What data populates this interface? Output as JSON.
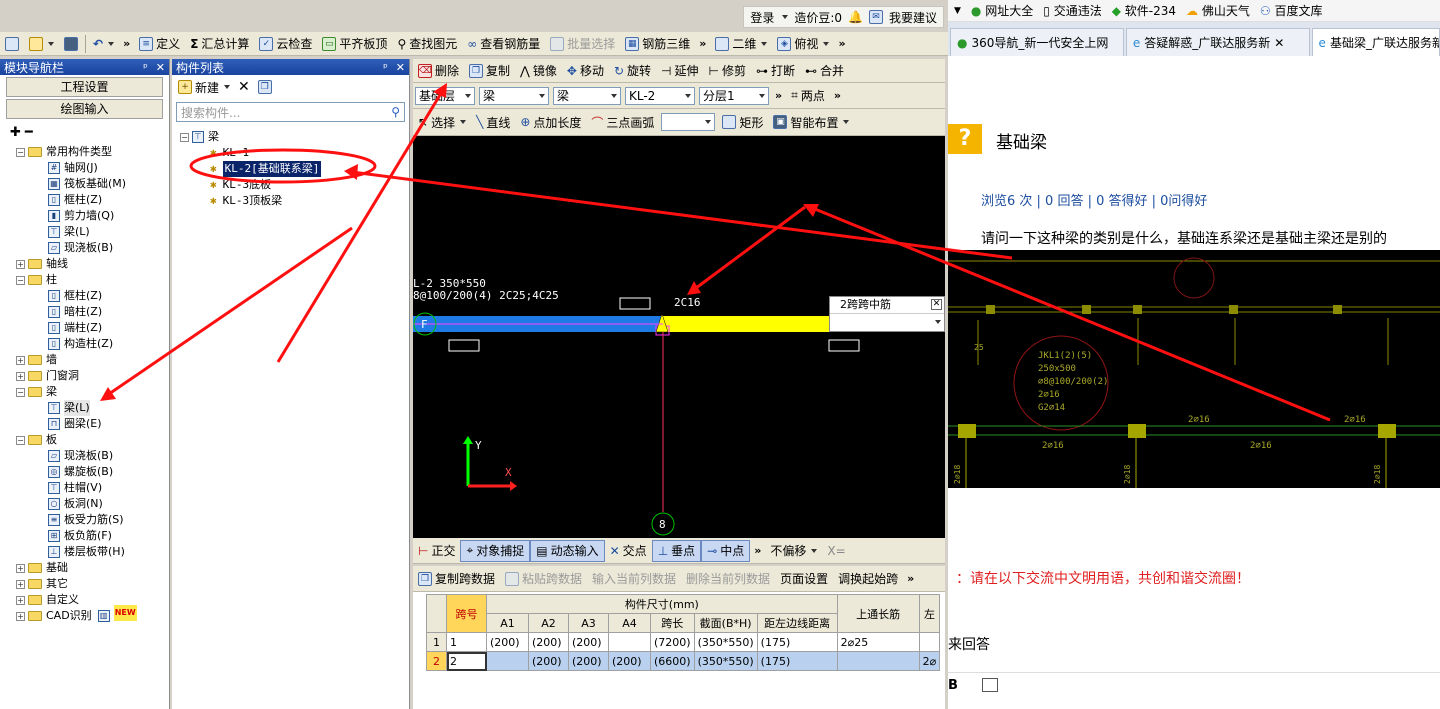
{
  "topbar": {
    "login": "登录",
    "cost_beans": "造价豆:0",
    "suggest": "我要建议"
  },
  "main_toolbar": {
    "items": [
      "定义",
      "汇总计算",
      "云检查",
      "平齐板顶",
      "查找图元",
      "查看钢筋量",
      "批量选择",
      "钢筋三维"
    ],
    "view_mode": "二维",
    "view_angle": "俯视"
  },
  "nav_panel": {
    "title": "模块导航栏",
    "project_settings": "工程设置",
    "drawing_input": "绘图输入",
    "tree": {
      "common": {
        "label": "常用构件类型",
        "children": [
          "轴网(J)",
          "筏板基础(M)",
          "框柱(Z)",
          "剪力墙(Q)",
          "梁(L)",
          "现浇板(B)"
        ]
      },
      "axis": "轴线",
      "column": {
        "label": "柱",
        "children": [
          "框柱(Z)",
          "暗柱(Z)",
          "端柱(Z)",
          "构造柱(Z)"
        ]
      },
      "wall": "墙",
      "doorwin": "门窗洞",
      "beam": {
        "label": "梁",
        "children": [
          "梁(L)",
          "圈梁(E)"
        ]
      },
      "slab": {
        "label": "板",
        "children": [
          "现浇板(B)",
          "螺旋板(B)",
          "柱帽(V)",
          "板洞(N)",
          "板受力筋(S)",
          "板负筋(F)",
          "楼层板带(H)"
        ]
      },
      "foundation": "基础",
      "other": "其它",
      "custom": "自定义",
      "cad": "CAD识别",
      "new_badge": "NEW"
    }
  },
  "comp_panel": {
    "title": "构件列表",
    "new_label": "新建",
    "search_placeholder": "搜索构件...",
    "group": "梁",
    "items": [
      "KL-1",
      "KL-2[基础联系梁]",
      "KL-3底板",
      "KL-3顶板梁"
    ]
  },
  "edit_toolbar": {
    "items": [
      "删除",
      "复制",
      "镜像",
      "移动",
      "旋转",
      "延伸",
      "修剪",
      "打断",
      "合并"
    ]
  },
  "props_toolbar": {
    "floor": "基础层",
    "type1": "梁",
    "type2": "梁",
    "name": "KL-2",
    "layer": "分层1",
    "two_point": "两点"
  },
  "draw_toolbar": {
    "items": [
      "选择",
      "直线",
      "点加长度",
      "三点画弧",
      "矩形",
      "智能布置"
    ]
  },
  "cad": {
    "label_line1": "L-2 350*550",
    "label_line2": "8@100/200(4) 2C25;4C25",
    "rebar_label": "2C16",
    "axis_f": "F",
    "axis_8": "8",
    "popup_text": "2跨跨中筋",
    "y_axis": "Y",
    "x_axis": "X"
  },
  "snap_bar": {
    "items": [
      "正交",
      "对象捕捉",
      "动态输入",
      "交点",
      "垂点",
      "中点"
    ],
    "offset": "不偏移",
    "x_field": "X="
  },
  "span_toolbar": {
    "items": [
      "复制跨数据",
      "粘贴跨数据",
      "输入当前列数据",
      "删除当前列数据",
      "页面设置",
      "调换起始跨"
    ]
  },
  "span_table": {
    "group_header": "构件尺寸(mm)",
    "col_span": "跨号",
    "col_top": "上通长筋",
    "sub_headers": [
      "A1",
      "A2",
      "A3",
      "A4",
      "跨长",
      "截面(B*H)",
      "距左边线距离"
    ],
    "rows": [
      {
        "n": "1",
        "span": "1",
        "a1": "(200)",
        "a2": "(200)",
        "a3": "(200)",
        "a4": "",
        "len": "(7200)",
        "sec": "(350*550)",
        "dist": "(175)",
        "top": "2⌀25"
      },
      {
        "n": "2",
        "span": "2",
        "a1": "",
        "a2": "(200)",
        "a3": "(200)",
        "a4": "(200)",
        "len": "(6600)",
        "sec": "(350*550)",
        "dist": "(175)",
        "top": "2⌀"
      }
    ]
  },
  "browser": {
    "bookmarks": [
      "网址大全",
      "交通违法",
      "软件-234",
      "佛山天气",
      "百度文库"
    ],
    "tabs": [
      "360导航_新一代安全上网",
      "答疑解惑_广联达服务新",
      "基础梁_广联达服务新"
    ]
  },
  "question": {
    "title": "基础梁",
    "stats": "浏览6 次 | 0 回答 | 0 答得好 | 0问得好",
    "body": "请问一下这种梁的类别是什么，基础连系梁还是基础主梁还是别的",
    "notice": "：请在以下交流中文明用语，共创和谐交流圈！",
    "answer_label": "来回答",
    "cad_labels": [
      "JKL1(2)(5)",
      "250x500",
      "⌀8@100/200(2)",
      "2⌀16",
      "G2⌀14",
      "2⌀16",
      "2⌀16",
      "2⌀16",
      "2⌀16",
      "2⌀18",
      "2⌀18",
      "2⌀18",
      "25"
    ]
  },
  "colors": {
    "annotation": "#ff1010",
    "beam_blue": "#1e7be6",
    "beam_yellow": "#ffff00",
    "cad_bg": "#000000"
  }
}
